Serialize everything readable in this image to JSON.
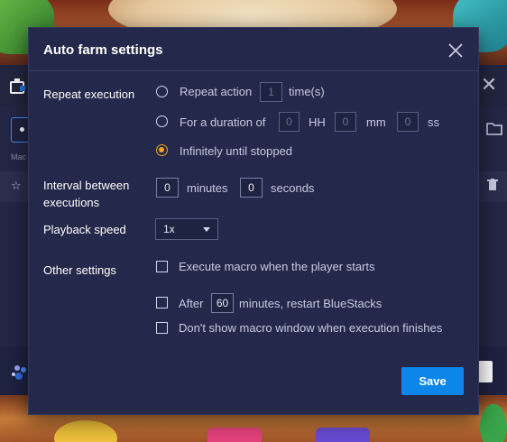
{
  "dialog": {
    "title": "Auto farm settings",
    "close_icon": "close-icon",
    "repeat_execution": {
      "label": "Repeat execution",
      "options": {
        "repeat_action": {
          "prefix": "Repeat action",
          "value": "1",
          "suffix": "time(s)",
          "selected": false
        },
        "duration": {
          "prefix": "For a duration of",
          "hh_value": "0",
          "hh_label": "HH",
          "mm_value": "0",
          "mm_label": "mm",
          "ss_value": "0",
          "ss_label": "ss",
          "selected": false
        },
        "infinite": {
          "label": "Infinitely until stopped",
          "selected": true
        }
      }
    },
    "interval": {
      "label": "Interval between executions",
      "minutes_value": "0",
      "minutes_label": "minutes",
      "seconds_value": "0",
      "seconds_label": "seconds"
    },
    "playback_speed": {
      "label": "Playback speed",
      "selected": "1x"
    },
    "other_settings": {
      "label": "Other settings",
      "execute_on_start": {
        "label": "Execute macro when the player starts",
        "checked": false
      },
      "restart": {
        "prefix": "After",
        "value": "60",
        "suffix": "minutes, restart BlueStacks",
        "checked": false
      },
      "dont_show": {
        "label": "Don't show macro window when execution finishes",
        "checked": false
      }
    },
    "save_label": "Save"
  },
  "background": {
    "macro_window_subtext": "Mac",
    "icons": [
      "macro-manager-icon",
      "close-icon",
      "folder-icon",
      "star-icon",
      "trash-icon",
      "users-icon"
    ]
  },
  "colors": {
    "dialog_bg": "#24284a",
    "accent_orange": "#f4a322",
    "save_blue": "#0d86ea",
    "text_primary": "#ffffff",
    "text_secondary": "#c8cae0"
  }
}
